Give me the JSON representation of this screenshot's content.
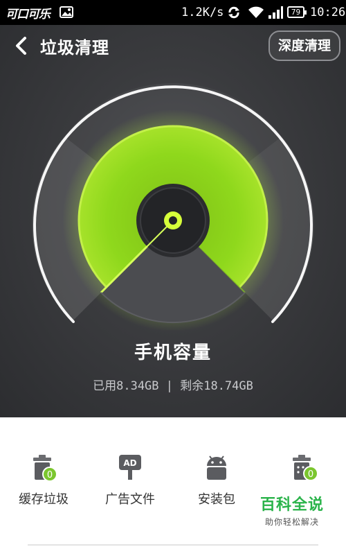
{
  "status_bar": {
    "brand": "可口可乐",
    "speed": "1.2K/s",
    "battery": "79",
    "time": "10:26"
  },
  "header": {
    "title": "垃圾清理",
    "deep_clean_label": "深度清理"
  },
  "storage": {
    "title": "手机容量",
    "usage_text": "已用8.34GB | 剩余18.74GB",
    "used_gb": 8.34,
    "free_gb": 18.74
  },
  "tools": [
    {
      "label": "缓存垃圾",
      "icon": "trash-can-icon",
      "badge": "0"
    },
    {
      "label": "广告文件",
      "icon": "ad-sign-icon"
    },
    {
      "label": "安装包",
      "icon": "android-icon"
    },
    {
      "label": "",
      "icon": "trash-bin-icon",
      "badge": "0"
    }
  ],
  "watermark": {
    "main": "百科全说",
    "sub": "助你轻松解决"
  },
  "colors": {
    "accent_green": "#a6e22a",
    "badge_green": "#7bc62e",
    "watermark_green": "#2ab34a",
    "dark_bg": "#3a3b3e"
  }
}
